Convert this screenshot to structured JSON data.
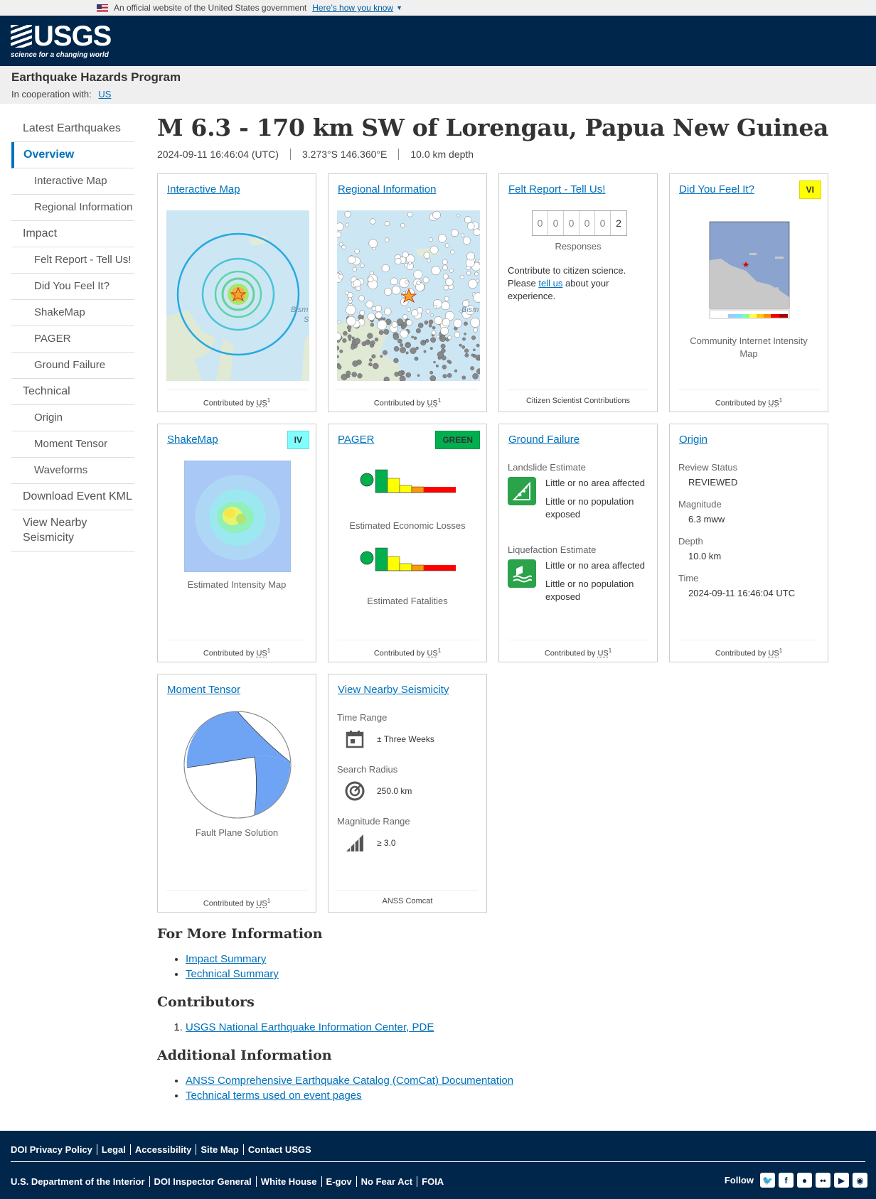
{
  "gov_banner": {
    "text": "An official website of the United States government",
    "link": "Here’s how you know"
  },
  "usgs": {
    "logo": "USGS",
    "tagline": "science for a changing world"
  },
  "program": {
    "name": "Earthquake Hazards Program",
    "coop_label": "In cooperation with:",
    "coop_link": "US"
  },
  "sidenav": [
    {
      "label": "Latest Earthquakes"
    },
    {
      "label": "Overview"
    },
    {
      "label": "Interactive Map"
    },
    {
      "label": "Regional Information"
    },
    {
      "label": "Impact"
    },
    {
      "label": "Felt Report - Tell Us!"
    },
    {
      "label": "Did You Feel It?"
    },
    {
      "label": "ShakeMap"
    },
    {
      "label": "PAGER"
    },
    {
      "label": "Ground Failure"
    },
    {
      "label": "Technical"
    },
    {
      "label": "Origin"
    },
    {
      "label": "Moment Tensor"
    },
    {
      "label": "Waveforms"
    },
    {
      "label": "Download Event KML"
    },
    {
      "label": "View Nearby Seismicity"
    }
  ],
  "event": {
    "title": "M 6.3 - 170 km SW of Lorengau, Papua New Guinea",
    "time": "2024-09-11 16:46:04 (UTC)",
    "location": "3.273°S 146.360°E",
    "depth": "10.0 km depth"
  },
  "contributed_by": "Contributed by",
  "contributor_code": "US",
  "contributor_sup": "1",
  "cards": {
    "interactive_map": {
      "title": "Interactive Map"
    },
    "regional": {
      "title": "Regional Information"
    },
    "felt": {
      "title": "Felt Report - Tell Us!",
      "digits": [
        "0",
        "0",
        "0",
        "0",
        "0",
        "2"
      ],
      "responses": "Responses",
      "text_before": "Contribute to citizen science. Please",
      "link": "tell us",
      "text_after": "about your experience.",
      "footer": "Citizen Scientist Contributions"
    },
    "dyfi": {
      "title": "Did You Feel It?",
      "badge": "VI",
      "badge_color": "#ffff00",
      "caption": "Community Internet Intensity Map"
    },
    "shakemap": {
      "title": "ShakeMap",
      "badge": "IV",
      "badge_color": "#80ffff",
      "caption": "Estimated Intensity Map"
    },
    "pager": {
      "title": "PAGER",
      "badge": "GREEN",
      "badge_color": "#00b04f",
      "losses": "Estimated Economic Losses",
      "fatalities": "Estimated Fatalities"
    },
    "ground_failure": {
      "title": "Ground Failure",
      "landslide_label": "Landslide Estimate",
      "landslide_area": "Little or no area affected",
      "landslide_pop": "Little or no population exposed",
      "liquefaction_label": "Liquefaction Estimate",
      "liquefaction_area": "Little or no area affected",
      "liquefaction_pop": "Little or no population exposed"
    },
    "origin": {
      "title": "Origin",
      "review_label": "Review Status",
      "review": "REVIEWED",
      "mag_label": "Magnitude",
      "mag": "6.3 mww",
      "depth_label": "Depth",
      "depth": "10.0 km",
      "time_label": "Time",
      "time": "2024-09-11 16:46:04 UTC"
    },
    "moment_tensor": {
      "title": "Moment Tensor",
      "caption": "Fault Plane Solution"
    },
    "nearby": {
      "title": "View Nearby Seismicity",
      "time_label": "Time Range",
      "time": "± Three Weeks",
      "radius_label": "Search Radius",
      "radius": "250.0 km",
      "mag_label": "Magnitude Range",
      "mag": "≥ 3.0",
      "footer": "ANSS Comcat"
    }
  },
  "more_info": {
    "heading": "For More Information",
    "links": [
      "Impact Summary",
      "Technical Summary"
    ]
  },
  "contributors": {
    "heading": "Contributors",
    "items": [
      "USGS National Earthquake Information Center, PDE"
    ]
  },
  "additional": {
    "heading": "Additional Information",
    "links": [
      "ANSS Comprehensive Earthquake Catalog (ComCat) Documentation",
      "Technical terms used on event pages"
    ]
  },
  "footer": {
    "row1": [
      "DOI Privacy Policy",
      "Legal",
      "Accessibility",
      "Site Map",
      "Contact USGS"
    ],
    "row2": [
      "U.S. Department of the Interior",
      "DOI Inspector General",
      "White House",
      "E-gov",
      "No Fear Act",
      "FOIA"
    ],
    "follow": "Follow",
    "social_icons": [
      "twitter-icon",
      "facebook-icon",
      "github-icon",
      "flickr-icon",
      "youtube-icon",
      "instagram-icon"
    ]
  }
}
